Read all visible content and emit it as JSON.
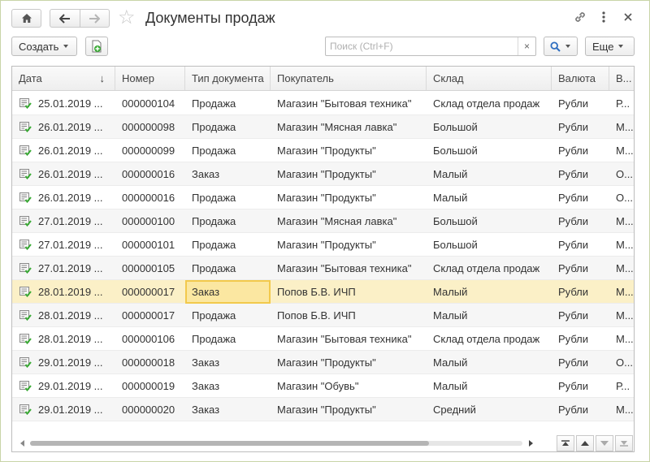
{
  "window": {
    "title": "Документы продаж",
    "icons": [
      "home-icon",
      "back-arrow-icon",
      "forward-arrow-icon",
      "star-icon",
      "link-icon",
      "more-vertical-icon",
      "close-icon"
    ]
  },
  "toolbar": {
    "create_label": "Создать",
    "search_placeholder": "Поиск (Ctrl+F)",
    "search_value": "",
    "clear_label": "×",
    "more_label": "Еще"
  },
  "columns": [
    {
      "key": "date",
      "label": "Дата",
      "sort": "desc"
    },
    {
      "key": "number",
      "label": "Номер"
    },
    {
      "key": "type",
      "label": "Тип документа"
    },
    {
      "key": "buyer",
      "label": "Покупатель"
    },
    {
      "key": "warehouse",
      "label": "Склад"
    },
    {
      "key": "currency",
      "label": "Валюта"
    },
    {
      "key": "extra",
      "label": "В..."
    }
  ],
  "rows": [
    {
      "date": "25.01.2019 ...",
      "number": "000000104",
      "type": "Продажа",
      "buyer": "Магазин \"Бытовая техника\"",
      "warehouse": "Склад отдела продаж",
      "currency": "Рубли",
      "extra": "Р..."
    },
    {
      "date": "26.01.2019 ...",
      "number": "000000098",
      "type": "Продажа",
      "buyer": "Магазин \"Мясная лавка\"",
      "warehouse": "Большой",
      "currency": "Рубли",
      "extra": "М..."
    },
    {
      "date": "26.01.2019 ...",
      "number": "000000099",
      "type": "Продажа",
      "buyer": "Магазин \"Продукты\"",
      "warehouse": "Большой",
      "currency": "Рубли",
      "extra": "М..."
    },
    {
      "date": "26.01.2019 ...",
      "number": "000000016",
      "type": "Заказ",
      "buyer": "Магазин \"Продукты\"",
      "warehouse": "Малый",
      "currency": "Рубли",
      "extra": "О..."
    },
    {
      "date": "26.01.2019 ...",
      "number": "000000016",
      "type": "Продажа",
      "buyer": "Магазин \"Продукты\"",
      "warehouse": "Малый",
      "currency": "Рубли",
      "extra": "О..."
    },
    {
      "date": "27.01.2019 ...",
      "number": "000000100",
      "type": "Продажа",
      "buyer": "Магазин \"Мясная лавка\"",
      "warehouse": "Большой",
      "currency": "Рубли",
      "extra": "М..."
    },
    {
      "date": "27.01.2019 ...",
      "number": "000000101",
      "type": "Продажа",
      "buyer": "Магазин \"Продукты\"",
      "warehouse": "Большой",
      "currency": "Рубли",
      "extra": "М..."
    },
    {
      "date": "27.01.2019 ...",
      "number": "000000105",
      "type": "Продажа",
      "buyer": "Магазин \"Бытовая техника\"",
      "warehouse": "Склад отдела продаж",
      "currency": "Рубли",
      "extra": "М..."
    },
    {
      "date": "28.01.2019 ...",
      "number": "000000017",
      "type": "Заказ",
      "buyer": "Попов Б.В. ИЧП",
      "warehouse": "Малый",
      "currency": "Рубли",
      "extra": "М...",
      "selected": true
    },
    {
      "date": "28.01.2019 ...",
      "number": "000000017",
      "type": "Продажа",
      "buyer": "Попов Б.В. ИЧП",
      "warehouse": "Малый",
      "currency": "Рубли",
      "extra": "М..."
    },
    {
      "date": "28.01.2019 ...",
      "number": "000000106",
      "type": "Продажа",
      "buyer": "Магазин \"Бытовая техника\"",
      "warehouse": "Склад отдела продаж",
      "currency": "Рубли",
      "extra": "М..."
    },
    {
      "date": "29.01.2019 ...",
      "number": "000000018",
      "type": "Заказ",
      "buyer": "Магазин \"Продукты\"",
      "warehouse": "Малый",
      "currency": "Рубли",
      "extra": "О..."
    },
    {
      "date": "29.01.2019 ...",
      "number": "000000019",
      "type": "Заказ",
      "buyer": "Магазин \"Обувь\"",
      "warehouse": "Малый",
      "currency": "Рубли",
      "extra": "Р..."
    },
    {
      "date": "29.01.2019 ...",
      "number": "000000020",
      "type": "Заказ",
      "buyer": "Магазин \"Продукты\"",
      "warehouse": "Средний",
      "currency": "Рубли",
      "extra": "М..."
    }
  ],
  "scroll": {
    "horizontal_thumb_fraction": 0.81
  },
  "colors": {
    "selected_row": "#fbf0c7",
    "focus_cell": "#f2c94c",
    "doc_icon_check": "#3aaa35"
  }
}
